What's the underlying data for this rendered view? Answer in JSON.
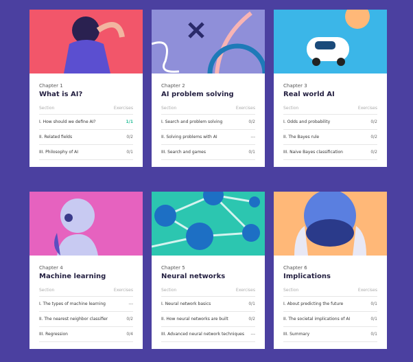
{
  "chapters": [
    {
      "chapter": "Chapter 1",
      "title": "What is AI?",
      "section_label": "Section",
      "exercises_label": "Exercises",
      "color": "#f2566a",
      "rows": [
        {
          "name": "I. How should we define AI?",
          "score": "1/1",
          "done": true
        },
        {
          "name": "II. Related fields",
          "score": "0/2"
        },
        {
          "name": "III. Philosophy of AI",
          "score": "0/1"
        }
      ]
    },
    {
      "chapter": "Chapter 2",
      "title": "AI problem solving",
      "section_label": "Section",
      "exercises_label": "Exercises",
      "color": "#8f8fd9",
      "rows": [
        {
          "name": "I. Search and problem solving",
          "score": "0/2"
        },
        {
          "name": "II. Solving problems with AI",
          "score": "---"
        },
        {
          "name": "III. Search and games",
          "score": "0/1"
        }
      ]
    },
    {
      "chapter": "Chapter 3",
      "title": "Real world AI",
      "section_label": "Section",
      "exercises_label": "Exercises",
      "color": "#3bb6e8",
      "rows": [
        {
          "name": "I. Odds and probability",
          "score": "0/2"
        },
        {
          "name": "II. The Bayes rule",
          "score": "0/2"
        },
        {
          "name": "III. Naive Bayes classification",
          "score": "0/2"
        }
      ]
    },
    {
      "chapter": "Chapter 4",
      "title": "Machine learning",
      "section_label": "Section",
      "exercises_label": "Exercises",
      "color": "#e662bf",
      "rows": [
        {
          "name": "I. The types of machine learning",
          "score": "---"
        },
        {
          "name": "II. The nearest neighbor classifier",
          "score": "0/2"
        },
        {
          "name": "III. Regression",
          "score": "0/4"
        }
      ]
    },
    {
      "chapter": "Chapter 5",
      "title": "Neural networks",
      "section_label": "Section",
      "exercises_label": "Exercises",
      "color": "#2cc6b0",
      "rows": [
        {
          "name": "I. Neural network basics",
          "score": "0/1"
        },
        {
          "name": "II. How neural networks are built",
          "score": "0/2"
        },
        {
          "name": "III. Advanced neural network techniques",
          "score": "---"
        }
      ]
    },
    {
      "chapter": "Chapter 6",
      "title": "Implications",
      "section_label": "Section",
      "exercises_label": "Exercises",
      "color": "#ffb878",
      "rows": [
        {
          "name": "I. About predicting the future",
          "score": "0/1"
        },
        {
          "name": "II. The societal implications of AI",
          "score": "0/1"
        },
        {
          "name": "III. Summary",
          "score": "0/1"
        }
      ]
    }
  ]
}
